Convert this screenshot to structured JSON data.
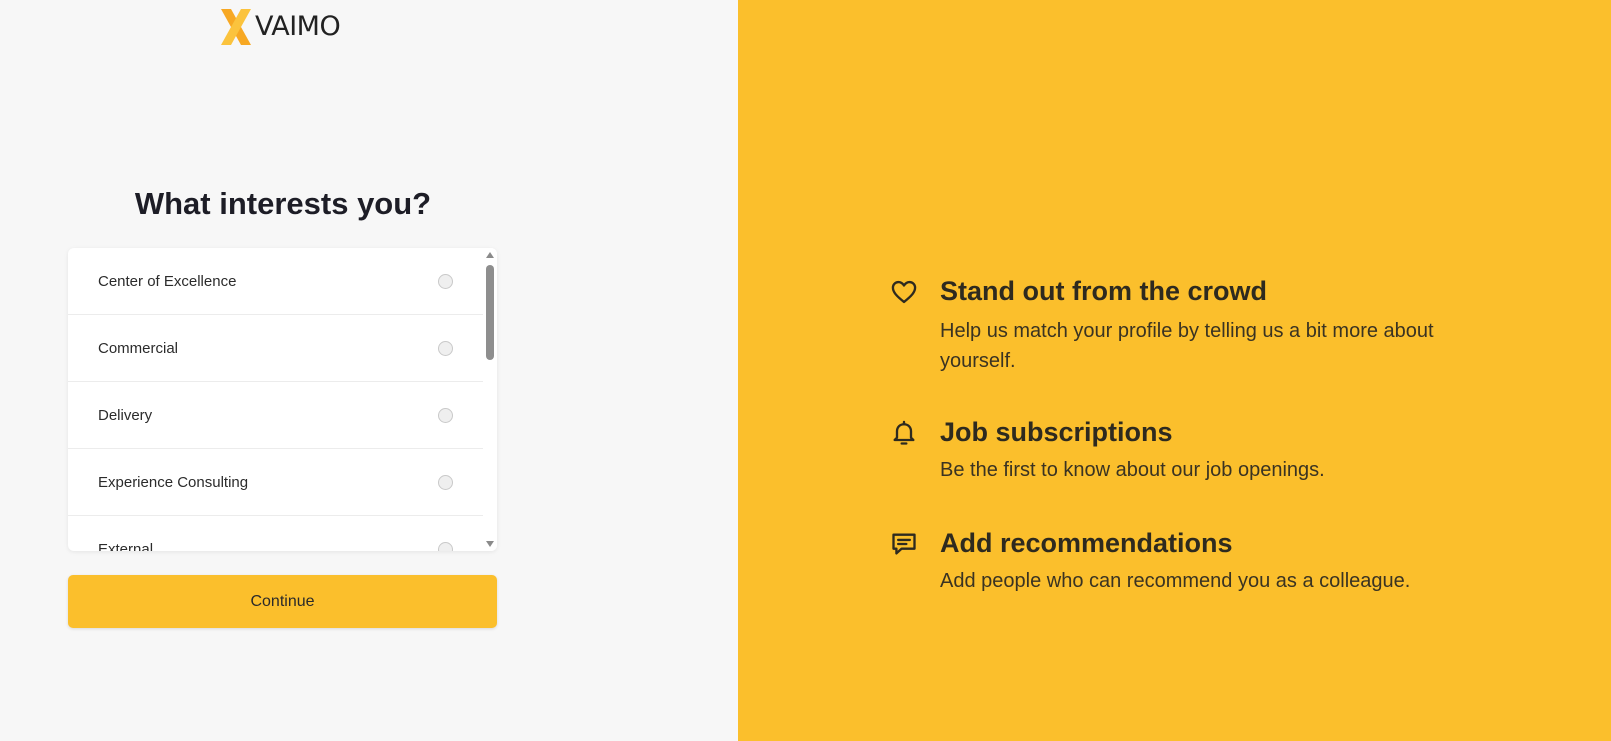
{
  "brand": {
    "name": "VAIMO",
    "logo_icon": "x-logo-mark",
    "accent_color": "#fbbf2c"
  },
  "form": {
    "title": "What interests you?",
    "options": [
      {
        "label": "Center of Excellence",
        "selected": false
      },
      {
        "label": "Commercial",
        "selected": false
      },
      {
        "label": "Delivery",
        "selected": false
      },
      {
        "label": "Experience Consulting",
        "selected": false
      },
      {
        "label": "External",
        "selected": false
      }
    ],
    "continue_label": "Continue"
  },
  "features": [
    {
      "icon": "heart-icon",
      "title": "Stand out from the crowd",
      "description": "Help us match your profile by telling us a bit more about yourself."
    },
    {
      "icon": "bell-icon",
      "title": "Job subscriptions",
      "description": "Be the first to know about our job openings."
    },
    {
      "icon": "chat-icon",
      "title": "Add recommendations",
      "description": "Add people who can recommend you as a colleague."
    }
  ]
}
